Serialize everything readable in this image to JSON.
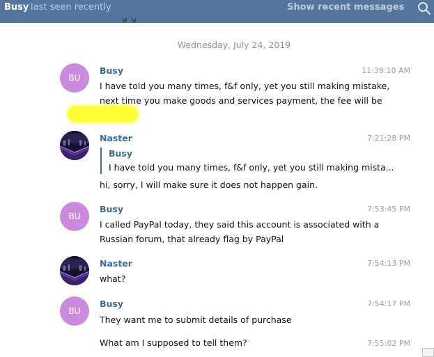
{
  "header": {
    "name": "Busy",
    "status": "last seen recently",
    "show_recent": "Show recent messages",
    "search_icon": "search-icon"
  },
  "cut_text": "ɡ ɡ",
  "date_separator": "Wednesday, July 24, 2019",
  "messages": [
    {
      "avatar": "BU",
      "sender": "Busy",
      "time": "11:39:10 AM",
      "lines": [
        "I have told you many times, f&f only, yet you still making mistake,",
        "next time you make goods and services payment, the fee will be"
      ]
    },
    {
      "sender": "Naster",
      "time": "7:21:28 PM",
      "reply": {
        "sender": "Busy",
        "text": "I have told you many times, f&f only, yet you still making mista..."
      },
      "lines": [
        "hi, sorry, I will make sure it does not happen gain."
      ]
    },
    {
      "avatar": "BU",
      "sender": "Busy",
      "time": "7:53:45 PM",
      "lines": [
        "I called PayPal today, they said this account is associated with a",
        "Russian forum, that already flag by PayPal"
      ]
    },
    {
      "sender": "Naster",
      "time": "7:54:13 PM",
      "lines": [
        "what?"
      ]
    },
    {
      "avatar": "BU",
      "sender": "Busy",
      "time": "7:54:17 PM",
      "lines": [
        "They want me to submit details of purchase"
      ]
    },
    {
      "time": "7:55:02 PM",
      "lines": [
        "What am I supposed to tell them?"
      ]
    }
  ]
}
